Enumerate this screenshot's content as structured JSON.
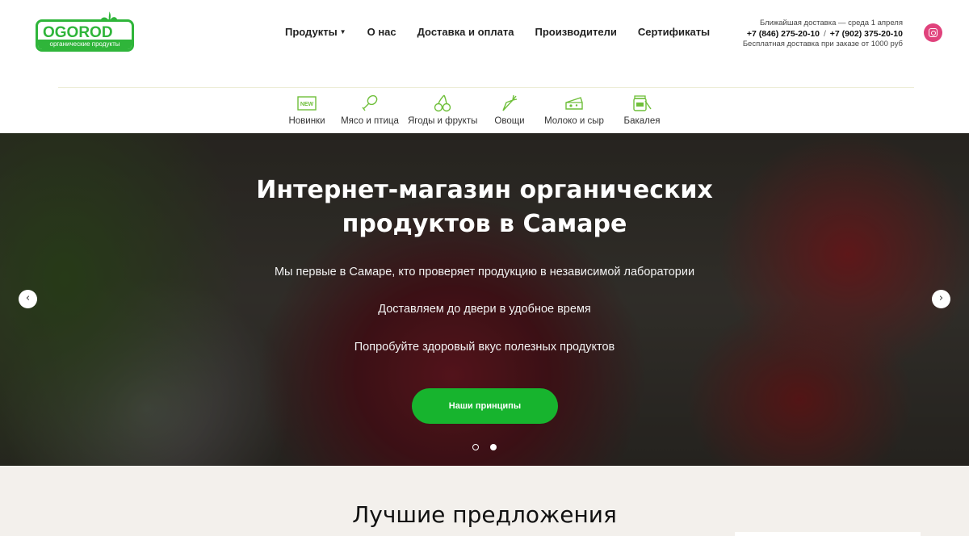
{
  "header": {
    "logo": {
      "text": "OGOROD",
      "subtitle": "органические продукты"
    },
    "nav": [
      {
        "label": "Продукты",
        "has_dropdown": true
      },
      {
        "label": "О нас"
      },
      {
        "label": "Доставка и оплата"
      },
      {
        "label": "Производители"
      },
      {
        "label": "Сертификаты"
      }
    ],
    "contact": {
      "delivery": "Ближайшая доставка — среда 1 апреля",
      "phone1": "+7 (846) 275-20-10",
      "phone_sep": "/",
      "phone2": "+7 (902) 375-20-10",
      "free_delivery": "Бесплатная доставка при заказе от 1000 руб"
    },
    "social": {
      "icon": "instagram-icon",
      "color": "#e0427c"
    }
  },
  "categories": [
    {
      "label": "Новинки",
      "icon": "new-badge-icon"
    },
    {
      "label": "Мясо и птица",
      "icon": "drumstick-icon"
    },
    {
      "label": "Ягоды и фрукты",
      "icon": "cherries-icon"
    },
    {
      "label": "Овощи",
      "icon": "carrot-icon"
    },
    {
      "label": "Молоко и сыр",
      "icon": "cheese-icon"
    },
    {
      "label": "Бакалея",
      "icon": "jar-icon"
    }
  ],
  "hero": {
    "title_line1": "Интернет-магазин органических",
    "title_line2": "продуктов в Самаре",
    "lines": [
      "Мы первые в Самаре, кто проверяет продукцию в независимой лаборатории",
      "Доставляем до двери в удобное время",
      "Попробуйте здоровый вкус полезных продуктов"
    ],
    "cta_label": "Наши принципы",
    "slides_total": 2,
    "active_slide": 2,
    "prev_arrow": "‹",
    "next_arrow": "›"
  },
  "offers": {
    "title": "Лучшие предложения"
  },
  "colors": {
    "brand_green": "#2fb53a",
    "cta_green": "#17b42e",
    "icon_green": "#6fbf3a"
  }
}
